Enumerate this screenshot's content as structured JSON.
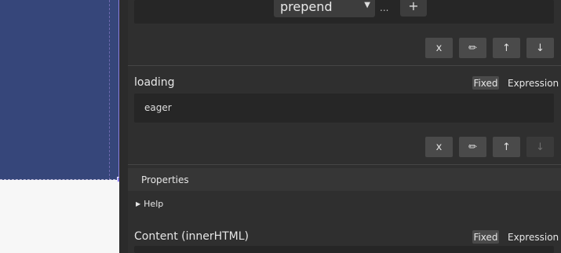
{
  "canvas": {
    "colors": {
      "element_fill": "#36467a",
      "selection": "#8a7ef0",
      "page_background": "#f7f7f7"
    }
  },
  "top_attribute": {
    "select_value": "prepend",
    "ellipsis": "...",
    "add_label": "+"
  },
  "row_buttons": {
    "remove": "x",
    "edit": "✏",
    "move_up": "↑",
    "move_down": "↓"
  },
  "loading_attribute": {
    "label": "loading",
    "mode_fixed": "Fixed",
    "mode_expression": "Expression",
    "value": "eager"
  },
  "properties": {
    "title": "Properties",
    "help": "Help"
  },
  "content_attribute": {
    "label": "Content (innerHTML)",
    "mode_fixed": "Fixed",
    "mode_expression": "Expression"
  },
  "theme": {
    "panel_bg": "#2f2f2f",
    "field_bg": "#262626",
    "button_bg": "#4a4a4a"
  }
}
